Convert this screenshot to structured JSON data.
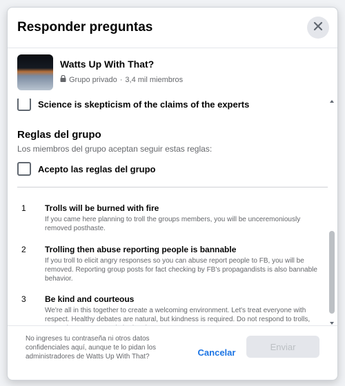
{
  "dialog": {
    "title": "Responder preguntas",
    "close_icon": "close-icon"
  },
  "group": {
    "name": "Watts Up With That?",
    "privacy": "Grupo privado",
    "separator": " · ",
    "members": "3,4 mil miembros",
    "lock_icon": "lock-icon"
  },
  "previous_answer": {
    "label": "Science is skepticism of the claims of the experts"
  },
  "rules": {
    "heading": "Reglas del grupo",
    "subheading": "Los miembros del grupo aceptan seguir estas reglas:",
    "accept_label": "Acepto las reglas del grupo",
    "items": [
      {
        "number": "1",
        "title": "Trolls will be burned with fire",
        "description": "If you came here planning to troll the groups members, you will be unceremoniously removed posthaste."
      },
      {
        "number": "2",
        "title": "Trolling then abuse reporting people is bannable",
        "description": "If you troll to elicit angry responses so you can abuse report people to FB, you will be removed. Reporting group posts for fact checking by FB's propagandists is also bannable behavior."
      },
      {
        "number": "3",
        "title": "Be kind and courteous",
        "description": "We're all in this together to create a welcoming environment. Let's treat everyone with respect. Healthy debates are natural, but kindness is required. Do not respond to trolls, report them to group admins/mods."
      }
    ]
  },
  "footer": {
    "note": "No ingreses tu contraseña ni otros datos confidenciales aquí, aunque te lo pidan los administradores de Watts Up With That?",
    "cancel_label": "Cancelar",
    "send_label": "Enviar"
  },
  "colors": {
    "accent": "#1b74e4",
    "disabled_bg": "#e4e6eb",
    "muted_text": "#65676b"
  }
}
